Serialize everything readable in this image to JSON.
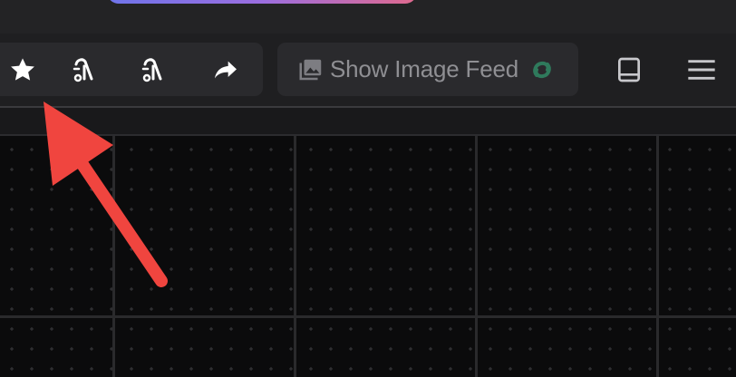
{
  "toolbar": {
    "star_icon": "star-icon",
    "reaction_icon_1": "hand-reaction-icon",
    "reaction_icon_2": "hand-reaction-icon",
    "share_icon": "share-arrow-icon",
    "image_feed": {
      "label": "Show Image Feed",
      "icon": "image-icon",
      "badge_icon": "refresh-logo-icon",
      "badge_color": "#2f7a5c"
    },
    "panel_icon": "panel-bottom-icon",
    "menu_icon": "hamburger-menu-icon"
  },
  "colors": {
    "accent_gradient_start": "#6f74ea",
    "accent_gradient_end": "#e06a8e",
    "annotation_arrow": "#f0453f"
  }
}
